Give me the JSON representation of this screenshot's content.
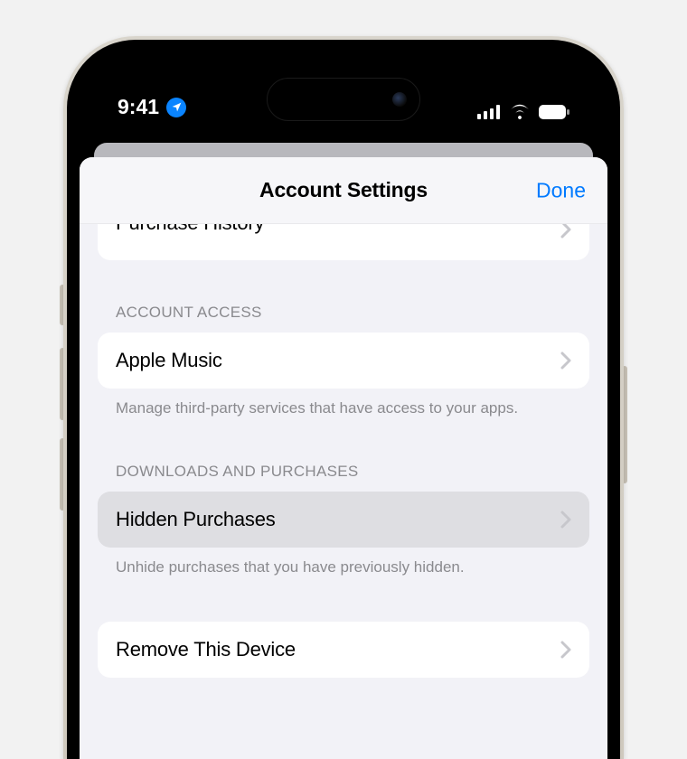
{
  "status": {
    "time": "9:41"
  },
  "sheet": {
    "title": "Account Settings",
    "done_label": "Done"
  },
  "partial_row": {
    "label": "Purchase History"
  },
  "sections": {
    "account_access": {
      "header": "ACCOUNT ACCESS",
      "row_label": "Apple Music",
      "footer": "Manage third-party services that have access to your apps."
    },
    "downloads": {
      "header": "DOWNLOADS AND PURCHASES",
      "hidden_label": "Hidden Purchases",
      "footer": "Unhide purchases that you have previously hidden.",
      "remove_label": "Remove This Device"
    }
  }
}
